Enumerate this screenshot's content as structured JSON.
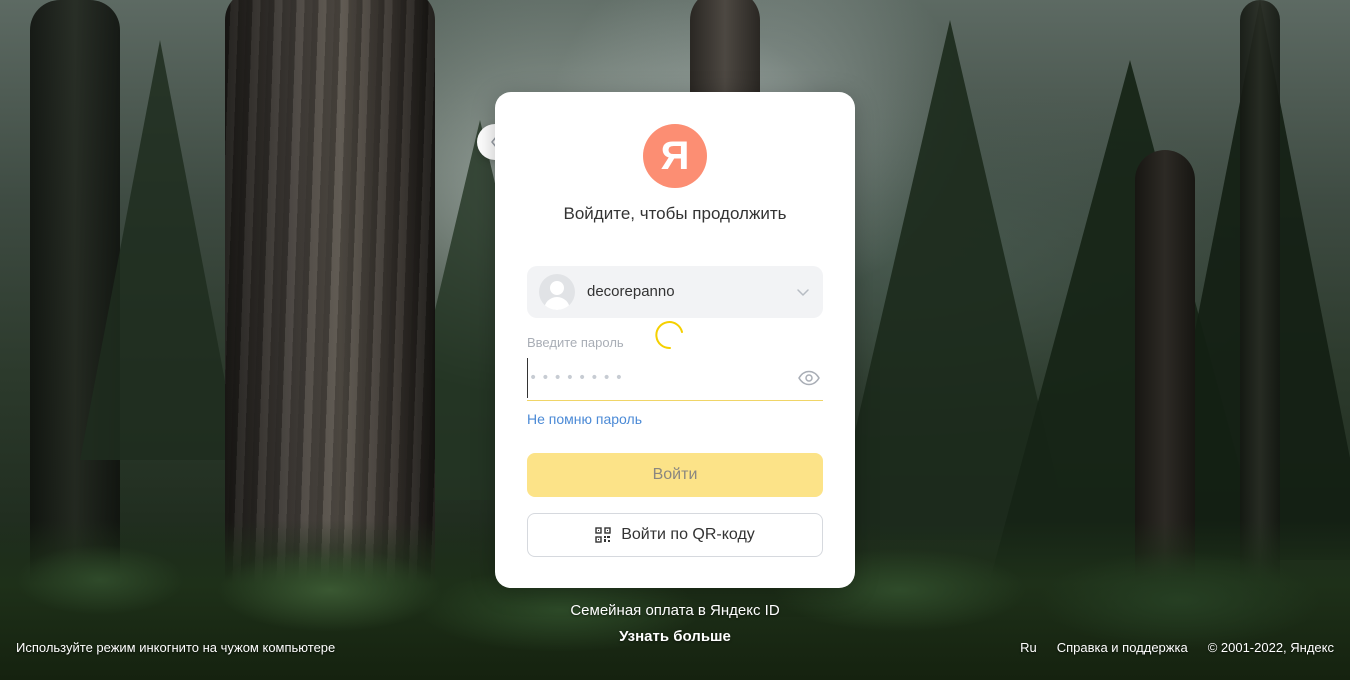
{
  "background": {
    "description_icon": "forest-background"
  },
  "card": {
    "logo_letter": "Я",
    "logo_color": "#fc8e73",
    "title": "Войдите, чтобы продолжить",
    "account": {
      "username": "decorepanno"
    },
    "password": {
      "label": "Введите пароль",
      "placeholder": "••••••••",
      "value": ""
    },
    "forgot_link": "Не помню пароль",
    "login_button": "Войти",
    "login_button_color": "#fce388",
    "qr_button": "Войти по QR-коду"
  },
  "promo": {
    "text": "Семейная оплата в Яндекс ID",
    "link": "Узнать больше"
  },
  "footer": {
    "incognito_hint": "Используйте режим инкогнито на чужом компьютере",
    "language": "Ru",
    "help": "Справка и поддержка",
    "copyright": "© 2001-2022, Яндекс"
  },
  "colors": {
    "link": "#4b8ad6",
    "input_underline": "#f0d567",
    "spinner": "#f5d000"
  }
}
